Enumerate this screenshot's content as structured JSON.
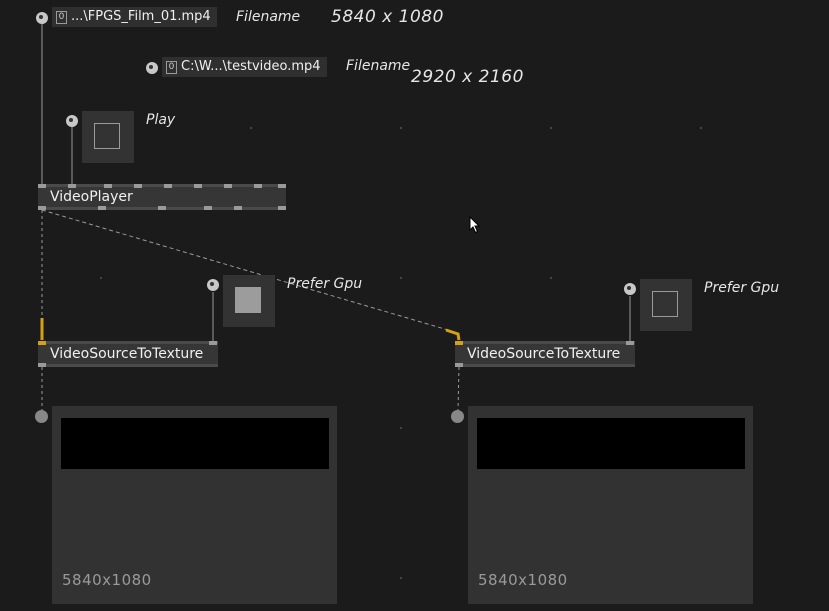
{
  "inputs": {
    "filename_1": {
      "value": "...\\FPGS_Film_01.mp4",
      "label": "Filename",
      "resolution": "5840 x 1080"
    },
    "filename_2": {
      "value": "C:\\W...\\testvideo.mp4",
      "label": "Filename",
      "resolution": "2920 x 2160"
    },
    "play": {
      "label": "Play",
      "checked": false
    },
    "prefer_gpu_1": {
      "label": "Prefer Gpu",
      "checked": true
    },
    "prefer_gpu_2": {
      "label": "Prefer Gpu",
      "checked": false
    },
    "zero_glyph": "0"
  },
  "nodes": {
    "video_player": {
      "label": "VideoPlayer"
    },
    "vstt_1": {
      "label": "VideoSourceToTexture"
    },
    "vstt_2": {
      "label": "VideoSourceToTexture"
    }
  },
  "previews": {
    "left": {
      "resolution": "5840x1080"
    },
    "right": {
      "resolution": "5840x1080"
    }
  },
  "colors": {
    "background": "#1b1b1b",
    "node": "#363636",
    "selected_link": "#d4a017",
    "link": "#9a9a9a"
  },
  "icons": {
    "cursor": "mouse-pointer-icon"
  }
}
